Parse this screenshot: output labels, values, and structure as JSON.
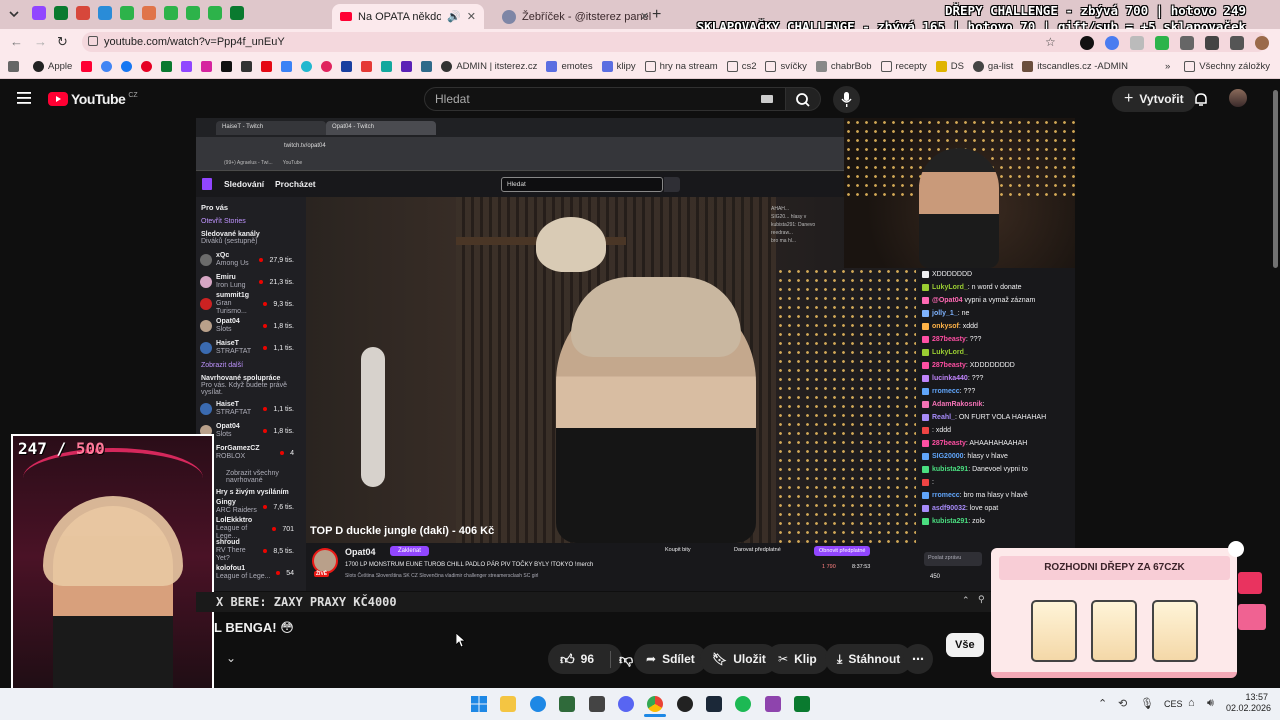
{
  "browser": {
    "url": "youtube.com/watch?v=Ppp4f_unEuY",
    "tabs": [
      {
        "label": "Na OPATA někdo ZAVOLAL"
      },
      {
        "label": "Žebříček - @itsterez panel"
      }
    ]
  },
  "overlay": {
    "line1": "DŘEPY CHALLENGE - zbývá 700 | hotovo 249",
    "line2": "SKLAPOVAČKY CHALLENGE - zbývá 165 | hotovo 70 | gift/sub = +5 sklapovaček",
    "counter_current": "247",
    "counter_separator": " / ",
    "counter_goal": "500",
    "ticker": "X BERE: ZAXY  PRAXY  KČ4000"
  },
  "bookmarks": [
    "Apple",
    "ADMIN | itsterez.cz",
    "emotes",
    "klipy",
    "hry na stream",
    "cs2",
    "svíčky",
    "chabrBob",
    "recepty",
    "DS",
    "ga-list",
    "itscandles.cz -ADMIN",
    "Všechny záložky"
  ],
  "youtube": {
    "logo_text": "YouTube",
    "country": "CZ",
    "search_placeholder": "Hledat",
    "create": "Vytvořit"
  },
  "inner_browser": {
    "tabs": [
      "HaiseT - Twitch",
      "Opat04 - Twitch"
    ],
    "url": "twitch.tv/opat04",
    "bookmarks": [
      "(99+) Agraelus - Twi...",
      "YouTube"
    ]
  },
  "twitch": {
    "nav": [
      "Sledování",
      "Procházet"
    ],
    "search_placeholder": "Hledat",
    "sidebar": {
      "for_you": "Pro vás",
      "stories": "Otevřít Stories",
      "followed": "Sledované kanály",
      "followed_sub": "Diváků (sestupně)",
      "show_more": "Zobrazit další",
      "recommended": "Navrhované spolupráce",
      "recommended_sub": "Pro vás. Když budete právě vysílat.",
      "show_all": "Zobrazit všechny navrhované",
      "live": "Hry s živým vysíláním",
      "channels": [
        {
          "name": "xQc",
          "game": "Among Us",
          "viewers": "27,9 tis.",
          "color": "#6b6b6b"
        },
        {
          "name": "Emiru",
          "game": "Iron Lung",
          "viewers": "21,3 tis.",
          "color": "#d6a6c4"
        },
        {
          "name": "summit1g",
          "game": "Gran Turismo...",
          "viewers": "9,3 tis.",
          "color": "#c22"
        },
        {
          "name": "Opat04",
          "game": "Slots",
          "viewers": "1,8 tis.",
          "color": "#b9a08a"
        },
        {
          "name": "HaiseT",
          "game": "STRAFTAT",
          "viewers": "1,1 tis.",
          "color": "#3a6ab0"
        }
      ],
      "recommended_channels": [
        {
          "name": "HaiseT",
          "game": "STRAFTAT",
          "viewers": "1,1 tis.",
          "color": "#3a6ab0"
        },
        {
          "name": "Opat04",
          "game": "Slots",
          "viewers": "1,8 tis.",
          "color": "#b9a08a"
        },
        {
          "name": "ForGamezCZ",
          "game": "ROBLOX",
          "viewers": "4",
          "color": "#888"
        }
      ],
      "live_channels": [
        {
          "name": "Gingy",
          "game": "ARC Raiders",
          "viewers": "7,6 tis.",
          "color": "#a37"
        },
        {
          "name": "LolEkkktro",
          "game": "League of Lege...",
          "viewers": "701",
          "color": "#557"
        },
        {
          "name": "shroud",
          "game": "RV There Yet?",
          "viewers": "8,5 tis.",
          "color": "#333"
        },
        {
          "name": "kolofou1",
          "game": "League of Lege...",
          "viewers": "54",
          "color": "#795"
        }
      ]
    },
    "stream_title_overlay": "TOP D  duckle jungle (dakí) - 406 Kč",
    "mini_chat": [
      "AHAH...",
      "SIG20... hlasy v",
      "kubista291: Danevo",
      "reedraw...",
      "bro ma hl..."
    ],
    "channel": "Opat04",
    "follow_label": "Zakleпat",
    "live_badge": "ŽIVĚ",
    "stream_title": "1700 LP MONSTRUM EUNE TUROB CHILL PADLO PÁR PIV TOČKY BYLY !TOKYO !merch",
    "tags": "Slots  Čeština  Slovenština  SK  CZ  Slovenčina  vladimir  challenger  streamersclash  SC  girl",
    "buy_bits": "Koupit bity",
    "gift_sub": "Darovat předplatné",
    "renew_sub": "Obnovit předplatné",
    "viewers": "1 790",
    "uptime": "8:37:53",
    "chat": [
      {
        "user": "",
        "text": "XDDDDDDD",
        "color": "#efeff1"
      },
      {
        "user": "LukyLord_",
        "text": ": n word v donate",
        "color": "#9acd32"
      },
      {
        "user": "@Opat04",
        "text": " vypni a vymaž záznam",
        "color": "#ff69b4"
      },
      {
        "user": "jolly_1_",
        "text": ": ne",
        "color": "#7fb3ff"
      },
      {
        "user": "onkysof",
        "text": ": xddd",
        "color": "#ffb347"
      },
      {
        "user": "287beasty",
        "text": ": ???",
        "color": "#ff4fa3"
      },
      {
        "user": "LukyLord_",
        "text": "",
        "color": "#9acd32"
      },
      {
        "user": "287beasty",
        "text": ": XDDDDDDDD",
        "color": "#ff4fa3"
      },
      {
        "user": "lucinka440",
        "text": ": ???",
        "color": "#c084fc"
      },
      {
        "user": "rromecc",
        "text": ": ???",
        "color": "#60a5fa"
      },
      {
        "user": "AdamRakosnik",
        "text": ":",
        "color": "#f472b6"
      },
      {
        "user": "Reahl_",
        "text": ": ON FURT VOLA HAHAHAH",
        "color": "#a78bfa"
      },
      {
        "user": "",
        "text": ": xddd",
        "color": "#ef4444"
      },
      {
        "user": "287beasty",
        "text": ": AHAAHAHAAHAH",
        "color": "#ff4fa3"
      },
      {
        "user": "SIG20000",
        "text": ": hlasy v hlave",
        "color": "#60a5fa"
      },
      {
        "user": "kubista291",
        "text": ": Danevoel vypni to",
        "color": "#4ade80"
      },
      {
        "user": "",
        "text": ":",
        "color": "#ef4444"
      },
      {
        "user": "rromecc",
        "text": ": bro ma hlasy v hlavě",
        "color": "#60a5fa"
      },
      {
        "user": "asdf90032",
        "text": ": love opat",
        "color": "#a78bfa"
      },
      {
        "user": "kubista291",
        "text": ": zolo",
        "color": "#4ade80"
      }
    ],
    "chat_send": "Poslat zprávu",
    "points": "450"
  },
  "video": {
    "title": "L BENGA! 😳",
    "likes": "96",
    "actions": {
      "share": "Sdílet",
      "save": "Uložit",
      "clip": "Klip",
      "download": "Stáhnout"
    },
    "chip_all": "Vše"
  },
  "popup": {
    "title": "ROZHODNI DŘEPY ZA 67CZK"
  },
  "taskbar": {
    "language": "CES",
    "time": "13:57",
    "date": "02.02.2026"
  }
}
